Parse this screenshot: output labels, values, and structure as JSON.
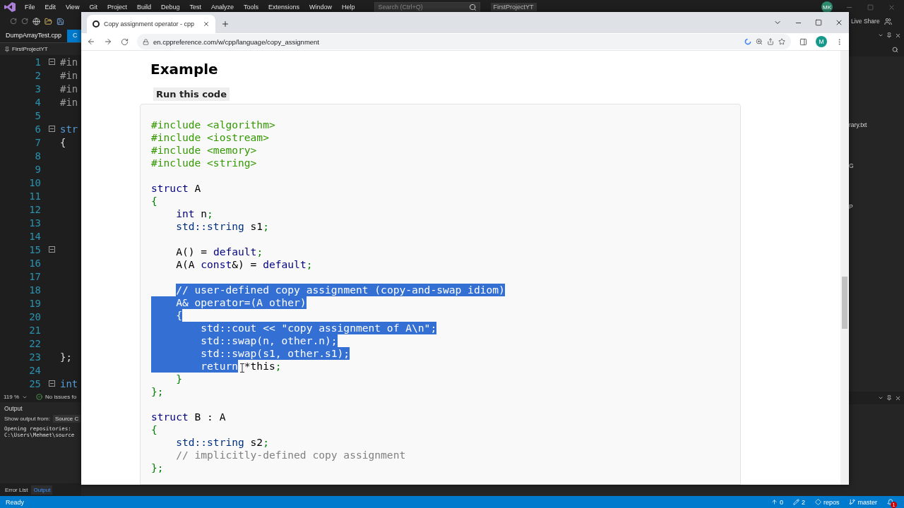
{
  "ide": {
    "menu": [
      "File",
      "Edit",
      "View",
      "Git",
      "Project",
      "Build",
      "Debug",
      "Test",
      "Analyze",
      "Tools",
      "Extensions",
      "Window",
      "Help"
    ],
    "search": {
      "placeholder": "Search (Ctrl+Q)"
    },
    "solution_name": "FirstProjectYT",
    "user_initials": "MK",
    "live_share": "Live Share",
    "file_tabs": [
      {
        "label": "DumpArrayTest.cpp",
        "selected": false
      },
      {
        "label": "C",
        "selected": true
      }
    ],
    "navigation": "FirstProjectYT",
    "editor_lines": [
      {
        "number": "1",
        "text": "#in",
        "kind": "pp",
        "fold": true
      },
      {
        "number": "2",
        "text": "#in",
        "kind": "pp",
        "fold": false
      },
      {
        "number": "3",
        "text": "#in",
        "kind": "pp",
        "fold": false
      },
      {
        "number": "4",
        "text": "#in",
        "kind": "pp",
        "fold": false
      },
      {
        "number": "5",
        "kind": "blank",
        "fold": false
      },
      {
        "number": "6",
        "text": "str",
        "kind": "kw",
        "fold": true
      },
      {
        "number": "7",
        "text": "{",
        "kind": "plain",
        "fold": false
      },
      {
        "number": "8",
        "kind": "blank",
        "fold": false
      },
      {
        "number": "9",
        "kind": "blank",
        "fold": false
      },
      {
        "number": "10",
        "kind": "blank",
        "fold": false
      },
      {
        "number": "11",
        "kind": "blank",
        "fold": false
      },
      {
        "number": "12",
        "kind": "blank",
        "fold": false
      },
      {
        "number": "13",
        "kind": "blank",
        "fold": false
      },
      {
        "number": "14",
        "kind": "blank",
        "fold": false
      },
      {
        "number": "15",
        "kind": "blank",
        "fold": true
      },
      {
        "number": "16",
        "kind": "blank",
        "fold": false
      },
      {
        "number": "17",
        "kind": "blank",
        "fold": false
      },
      {
        "number": "18",
        "kind": "blank",
        "fold": false
      },
      {
        "number": "19",
        "kind": "blank",
        "fold": false
      },
      {
        "number": "20",
        "kind": "blank",
        "fold": false
      },
      {
        "number": "21",
        "kind": "blank",
        "fold": false
      },
      {
        "number": "22",
        "kind": "blank",
        "fold": false
      },
      {
        "number": "23",
        "text": "};",
        "kind": "plain",
        "fold": false
      },
      {
        "number": "24",
        "kind": "blank",
        "fold": false
      },
      {
        "number": "25",
        "text": "int",
        "kind": "kw",
        "fold": true
      }
    ],
    "zoom": "119 %",
    "issues": "No issues fo",
    "output": {
      "title": "Output",
      "show_from_label": "Show output from:",
      "source": "Source C",
      "lines": [
        "Opening repositories:",
        "C:\\Users\\Mehmet\\source"
      ]
    },
    "bottom_tabs": [
      {
        "label": "Error List",
        "selected": false
      },
      {
        "label": "Output",
        "selected": true
      }
    ],
    "side_panel_items": [
      "rary.txt",
      "G",
      "P"
    ],
    "status": {
      "text": "Ready",
      "pushes": "0",
      "changes": "2",
      "repo": "repos",
      "branch": "master",
      "notifications": "1"
    }
  },
  "browser": {
    "tab_title": "Copy assignment operator - cpp",
    "url": "en.cppreference.com/w/cpp/language/copy_assignment",
    "profile_initial": "M",
    "heading": "Example",
    "run_button": "Run this code",
    "code_lines": [
      {
        "kind": "code",
        "segments": [
          {
            "text": "#include <algorithm>",
            "kind": "pp",
            "selected": false
          }
        ]
      },
      {
        "kind": "code",
        "segments": [
          {
            "text": "#include <iostream>",
            "kind": "pp",
            "selected": false
          }
        ]
      },
      {
        "kind": "code",
        "segments": [
          {
            "text": "#include <memory>",
            "kind": "pp",
            "selected": false
          }
        ]
      },
      {
        "kind": "code",
        "segments": [
          {
            "text": "#include <string>",
            "kind": "pp",
            "selected": false
          }
        ]
      },
      {
        "kind": "blank"
      },
      {
        "kind": "code",
        "segments": [
          {
            "text": "struct",
            "kind": "kw",
            "selected": false
          },
          {
            "text": " A",
            "kind": "plain",
            "selected": false
          }
        ]
      },
      {
        "kind": "code",
        "segments": [
          {
            "text": "{",
            "kind": "sym",
            "selected": false
          }
        ]
      },
      {
        "kind": "code",
        "segments": [
          {
            "text": "    int",
            "kind": "kw",
            "selected": false
          },
          {
            "text": " n",
            "kind": "plain",
            "selected": false
          },
          {
            "text": ";",
            "kind": "sym",
            "selected": false
          }
        ]
      },
      {
        "kind": "code",
        "segments": [
          {
            "text": "    std::string",
            "kind": "type",
            "selected": false
          },
          {
            "text": " s1",
            "kind": "plain",
            "selected": false
          },
          {
            "text": ";",
            "kind": "sym",
            "selected": false
          }
        ]
      },
      {
        "kind": "blank"
      },
      {
        "kind": "code",
        "segments": [
          {
            "text": "    A() = ",
            "kind": "plain",
            "selected": false
          },
          {
            "text": "default",
            "kind": "kw",
            "selected": false
          },
          {
            "text": ";",
            "kind": "sym",
            "selected": false
          }
        ]
      },
      {
        "kind": "code",
        "segments": [
          {
            "text": "    A(A ",
            "kind": "plain",
            "selected": false
          },
          {
            "text": "const",
            "kind": "kw",
            "selected": false
          },
          {
            "text": "&) = ",
            "kind": "plain",
            "selected": false
          },
          {
            "text": "default",
            "kind": "kw",
            "selected": false
          },
          {
            "text": ";",
            "kind": "sym",
            "selected": false
          }
        ]
      },
      {
        "kind": "blank"
      },
      {
        "kind": "code",
        "segments": [
          {
            "text": "    // user-defined copy assignment (copy-and-swap idiom)",
            "kind": "comment",
            "selected": true
          }
        ]
      },
      {
        "kind": "code",
        "segments": [
          {
            "text": "    A& operator=(A other)",
            "kind": "plain",
            "selected": true
          }
        ]
      },
      {
        "kind": "code",
        "segments": [
          {
            "text": "    {",
            "kind": "sym",
            "selected": true
          }
        ]
      },
      {
        "kind": "code",
        "segments": [
          {
            "text": "        std::cout << \"copy assignment of A\\n\";",
            "kind": "plain",
            "selected": true
          }
        ]
      },
      {
        "kind": "code",
        "segments": [
          {
            "text": "        std::swap(n, other.n);",
            "kind": "plain",
            "selected": true
          }
        ]
      },
      {
        "kind": "code",
        "segments": [
          {
            "text": "        std::swap(s1, other.s1);",
            "kind": "plain",
            "selected": true
          }
        ]
      },
      {
        "kind": "code",
        "segments": [
          {
            "text": "        return",
            "kind": "kw",
            "selected": true
          },
          {
            "text": " *this",
            "kind": "plain",
            "selected": false
          },
          {
            "text": ";",
            "kind": "sym",
            "selected": false
          }
        ]
      },
      {
        "kind": "code",
        "segments": [
          {
            "text": "    }",
            "kind": "sym",
            "selected": false
          }
        ]
      },
      {
        "kind": "code",
        "segments": [
          {
            "text": "};",
            "kind": "sym",
            "selected": false
          }
        ]
      },
      {
        "kind": "blank"
      },
      {
        "kind": "code",
        "segments": [
          {
            "text": "struct",
            "kind": "kw",
            "selected": false
          },
          {
            "text": " B : A",
            "kind": "plain",
            "selected": false
          }
        ]
      },
      {
        "kind": "code",
        "segments": [
          {
            "text": "{",
            "kind": "sym",
            "selected": false
          }
        ]
      },
      {
        "kind": "code",
        "segments": [
          {
            "text": "    std::string",
            "kind": "type",
            "selected": false
          },
          {
            "text": " s2",
            "kind": "plain",
            "selected": false
          },
          {
            "text": ";",
            "kind": "sym",
            "selected": false
          }
        ]
      },
      {
        "kind": "code",
        "segments": [
          {
            "text": "    // implicitly-defined copy assignment",
            "kind": "comment",
            "selected": false
          }
        ]
      },
      {
        "kind": "code",
        "segments": [
          {
            "text": "};",
            "kind": "sym",
            "selected": false
          }
        ]
      }
    ]
  }
}
